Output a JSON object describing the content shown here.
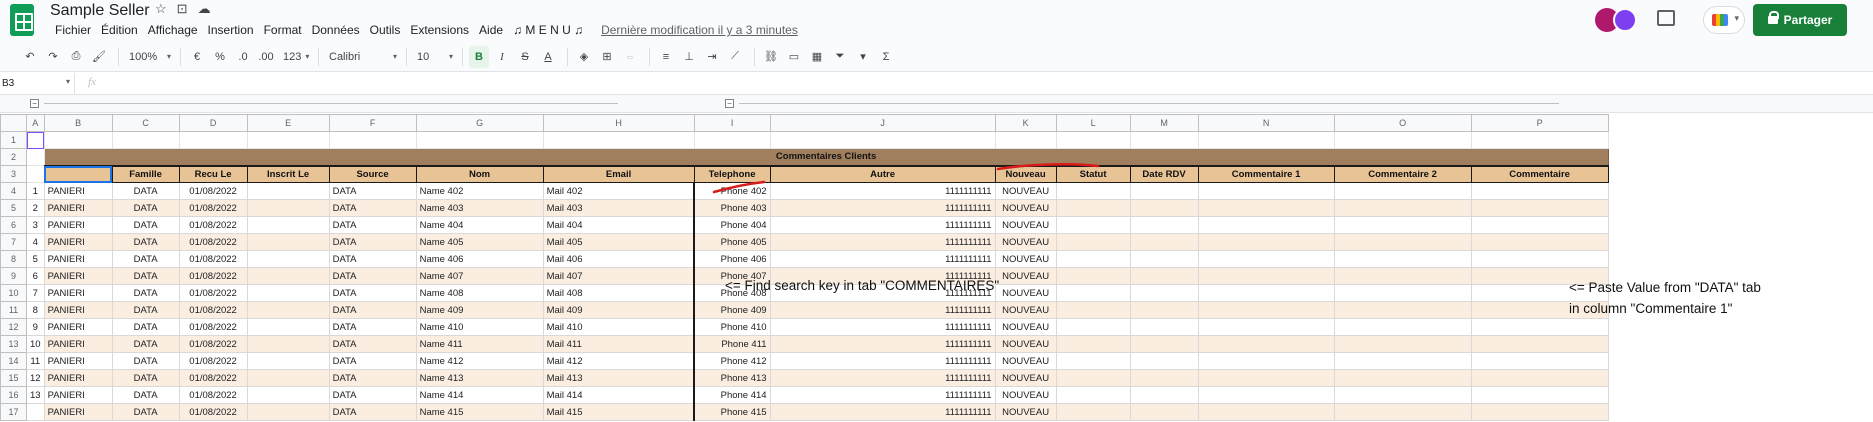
{
  "app": {
    "title": "Sample Seller",
    "menu": [
      "Fichier",
      "Édition",
      "Affichage",
      "Insertion",
      "Format",
      "Données",
      "Outils",
      "Extensions",
      "Aide",
      "♫ M E N U ♫"
    ],
    "last_edit": "Dernière modification il y a 3 minutes",
    "share_label": "Partager"
  },
  "toolbar": {
    "zoom": "100%",
    "currency": "€",
    "percent": "%",
    "decimals_less": ".0",
    "decimals_more": ".00",
    "format_more": "123",
    "font": "Calibri",
    "font_size": "10",
    "bold": "B",
    "italic": "I",
    "strike": "S",
    "text_color": "A",
    "function": "Σ"
  },
  "formula_bar": {
    "cell_ref": "B3",
    "fx": "fx",
    "value": ""
  },
  "columns": [
    "A",
    "B",
    "C",
    "D",
    "E",
    "F",
    "G",
    "H",
    "I",
    "J",
    "K",
    "L",
    "M",
    "N",
    "O",
    "P"
  ],
  "row_numbers": [
    "1",
    "2",
    "3",
    "4",
    "5",
    "6",
    "7",
    "8",
    "9",
    "10",
    "11",
    "12",
    "13",
    "14",
    "15",
    "16"
  ],
  "banner_title": "Commentaires Clients",
  "headers": [
    "",
    "Famille",
    "Recu Le",
    "Inscrit Le",
    "Source",
    "Nom",
    "Email",
    "Telephone",
    "Autre",
    "Nouveau",
    "Statut",
    "Date RDV",
    "Commentaire 1",
    "Commentaire 2",
    "Commentaire"
  ],
  "rows": [
    {
      "n": "1",
      "b": "PANIERI",
      "famille": "DATA",
      "recu": "01/08/2022",
      "source": "DATA",
      "nom": "Name 402",
      "email": "Mail 402",
      "tel": "Phone 402",
      "autre": "1111111111",
      "nouveau": "NOUVEAU"
    },
    {
      "n": "2",
      "b": "PANIERI",
      "famille": "DATA",
      "recu": "01/08/2022",
      "source": "DATA",
      "nom": "Name 403",
      "email": "Mail 403",
      "tel": "Phone 403",
      "autre": "1111111111",
      "nouveau": "NOUVEAU"
    },
    {
      "n": "3",
      "b": "PANIERI",
      "famille": "DATA",
      "recu": "01/08/2022",
      "source": "DATA",
      "nom": "Name 404",
      "email": "Mail 404",
      "tel": "Phone 404",
      "autre": "1111111111",
      "nouveau": "NOUVEAU"
    },
    {
      "n": "4",
      "b": "PANIERI",
      "famille": "DATA",
      "recu": "01/08/2022",
      "source": "DATA",
      "nom": "Name 405",
      "email": "Mail 405",
      "tel": "Phone 405",
      "autre": "1111111111",
      "nouveau": "NOUVEAU"
    },
    {
      "n": "5",
      "b": "PANIERI",
      "famille": "DATA",
      "recu": "01/08/2022",
      "source": "DATA",
      "nom": "Name 406",
      "email": "Mail 406",
      "tel": "Phone 406",
      "autre": "1111111111",
      "nouveau": "NOUVEAU"
    },
    {
      "n": "6",
      "b": "PANIERI",
      "famille": "DATA",
      "recu": "01/08/2022",
      "source": "DATA",
      "nom": "Name 407",
      "email": "Mail 407",
      "tel": "Phone 407",
      "autre": "1111111111",
      "nouveau": "NOUVEAU"
    },
    {
      "n": "7",
      "b": "PANIERI",
      "famille": "DATA",
      "recu": "01/08/2022",
      "source": "DATA",
      "nom": "Name 408",
      "email": "Mail 408",
      "tel": "Phone 408",
      "autre": "1111111111",
      "nouveau": "NOUVEAU"
    },
    {
      "n": "8",
      "b": "PANIERI",
      "famille": "DATA",
      "recu": "01/08/2022",
      "source": "DATA",
      "nom": "Name 409",
      "email": "Mail 409",
      "tel": "Phone 409",
      "autre": "1111111111",
      "nouveau": "NOUVEAU"
    },
    {
      "n": "9",
      "b": "PANIERI",
      "famille": "DATA",
      "recu": "01/08/2022",
      "source": "DATA",
      "nom": "Name 410",
      "email": "Mail 410",
      "tel": "Phone 410",
      "autre": "1111111111",
      "nouveau": "NOUVEAU"
    },
    {
      "n": "10",
      "b": "PANIERI",
      "famille": "DATA",
      "recu": "01/08/2022",
      "source": "DATA",
      "nom": "Name 411",
      "email": "Mail 411",
      "tel": "Phone 411",
      "autre": "1111111111",
      "nouveau": "NOUVEAU"
    },
    {
      "n": "11",
      "b": "PANIERI",
      "famille": "DATA",
      "recu": "01/08/2022",
      "source": "DATA",
      "nom": "Name 412",
      "email": "Mail 412",
      "tel": "Phone 412",
      "autre": "1111111111",
      "nouveau": "NOUVEAU"
    },
    {
      "n": "12",
      "b": "PANIERI",
      "famille": "DATA",
      "recu": "01/08/2022",
      "source": "DATA",
      "nom": "Name 413",
      "email": "Mail 413",
      "tel": "Phone 413",
      "autre": "1111111111",
      "nouveau": "NOUVEAU"
    },
    {
      "n": "13",
      "b": "PANIERI",
      "famille": "DATA",
      "recu": "01/08/2022",
      "source": "DATA",
      "nom": "Name 414",
      "email": "Mail 414",
      "tel": "Phone 414",
      "autre": "1111111111",
      "nouveau": "NOUVEAU"
    },
    {
      "n": "",
      "b": "PANIERI",
      "famille": "DATA",
      "recu": "01/08/2022",
      "source": "DATA",
      "nom": "Name 415",
      "email": "Mail 415",
      "tel": "Phone 415",
      "autre": "1111111111",
      "nouveau": "NOUVEAU"
    }
  ],
  "annotations": {
    "email_note": "<=  Find search key in tab \"COMMENTAIRES\"",
    "paste_note_line1": "<= Paste Value from \"DATA\" tab",
    "paste_note_line2": "in column \"Commentaire 1\""
  },
  "colors": {
    "banner": "#a07f5f",
    "header": "#e7c396",
    "stripe": "#fbeee0",
    "share": "#188038",
    "annotation_red": "#d81b1b"
  }
}
